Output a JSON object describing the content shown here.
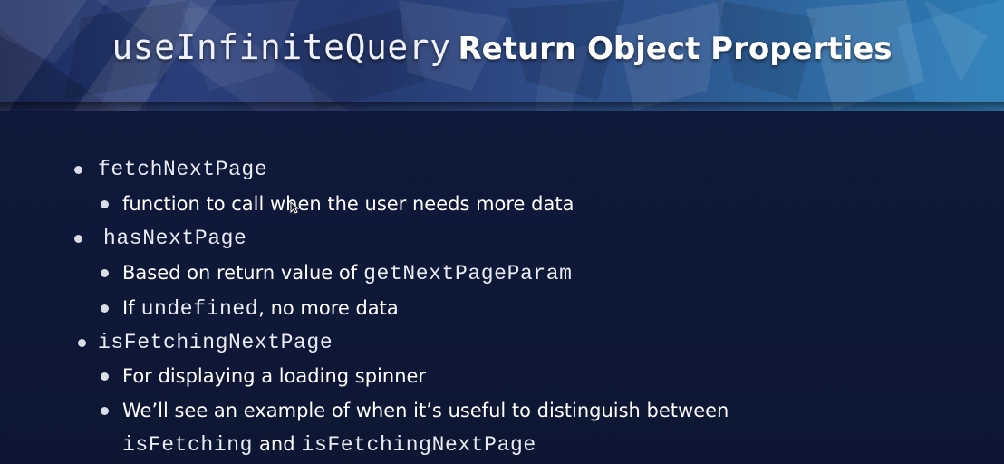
{
  "header": {
    "title_code": "useInfiniteQuery",
    "title_text": "Return Object Properties"
  },
  "bullets": [
    {
      "code": "fetchNextPage",
      "subs": [
        {
          "text": "function to call when the user needs more data"
        }
      ]
    },
    {
      "code": "hasNextPage",
      "subs": [
        {
          "prefix": "Based on return value of",
          "code": "getNextPageParam"
        },
        {
          "prefix": "If",
          "code": "undefined",
          "suffix": ", no more data"
        }
      ]
    },
    {
      "code": "isFetchingNextPage",
      "subs": [
        {
          "text": "For displaying a loading spinner"
        },
        {
          "text": "We’ll see an example of when it’s useful to distinguish between",
          "cont_code1": "isFetching",
          "cont_mid": "and",
          "cont_code2": "isFetchingNextPage"
        }
      ]
    }
  ],
  "colors": {
    "background": "#0f1a3c",
    "text": "#ffffff",
    "bullet": "#d9dde6",
    "header_left": "#1b2a5e",
    "header_right": "#2b7cb2"
  },
  "icons": {
    "cursor": "mouse-pointer-icon"
  }
}
